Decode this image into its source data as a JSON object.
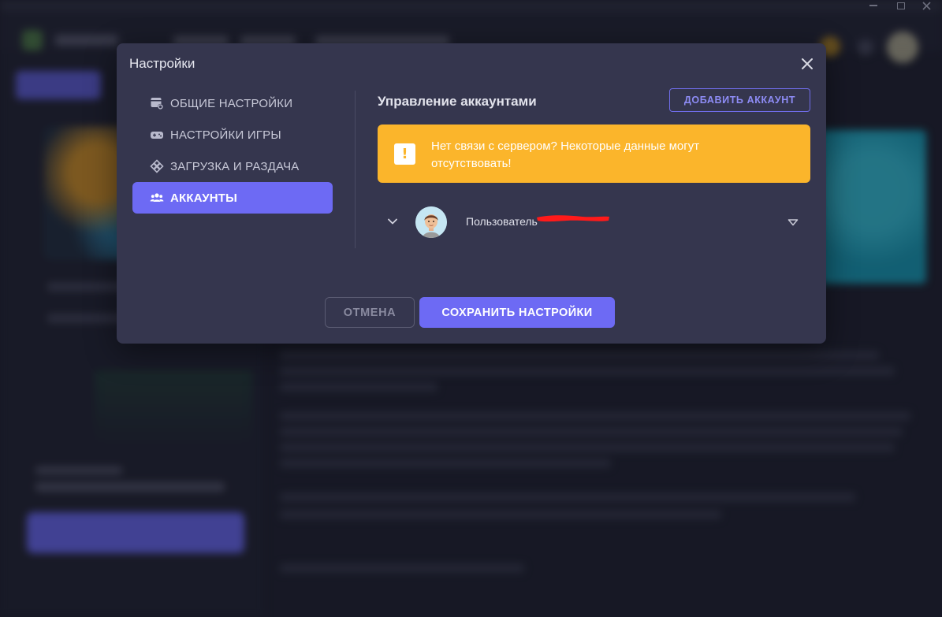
{
  "modal": {
    "title": "Настройки",
    "close_icon": "close-icon"
  },
  "nav": {
    "items": [
      {
        "label": "ОБЩИЕ НАСТРОЙКИ",
        "icon": "general-settings-icon",
        "active": false
      },
      {
        "label": "НАСТРОЙКИ ИГРЫ",
        "icon": "gamepad-icon",
        "active": false
      },
      {
        "label": "ЗАГРУЗКА И РАЗДАЧА",
        "icon": "download-share-icon",
        "active": false
      },
      {
        "label": "АККАУНТЫ",
        "icon": "users-icon",
        "active": true
      }
    ]
  },
  "accounts": {
    "title": "Управление аккаунтами",
    "add_button": "ДОБАВИТЬ АККАУНТ",
    "alert": {
      "icon": "warning-icon",
      "glyph": "!",
      "text": "Нет связи с сервером? Некоторые данные могут отсутствовать!"
    },
    "list": [
      {
        "name": "Пользователь"
      }
    ]
  },
  "footer": {
    "cancel_label": "ОТМЕНА",
    "save_label": "СОХРАНИТЬ НАСТРОЙКИ"
  },
  "colors": {
    "modal_bg": "#35364e",
    "accent": "#6d6af4",
    "alert_bg": "#fbb52b",
    "page_bg": "#1c1d2b"
  }
}
